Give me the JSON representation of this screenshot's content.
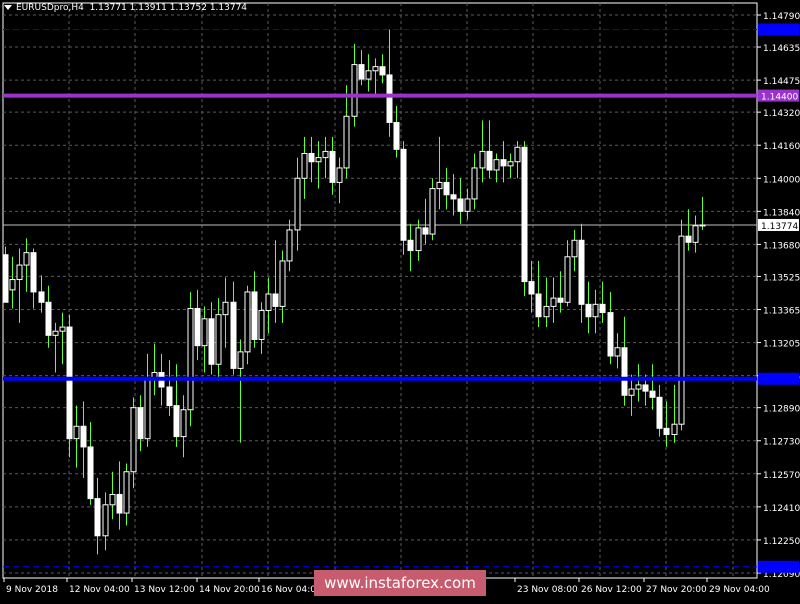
{
  "header": {
    "symbol_label": "EURUSDpro,H4",
    "ohlc": "1.13771 1.13911 1.13752 1.13774"
  },
  "watermark": "www.instaforex.com",
  "colors": {
    "background": "#000000",
    "grid": "#5a5a5a",
    "bull_body": "#000000",
    "bear_body": "#ffffff",
    "candle": "#ffffff",
    "wick": "#66ff33",
    "purple_level": "#9933cc",
    "blue_level": "#0000ff",
    "dashed_level": "#0000ff",
    "current_price": "#c0c0c0",
    "axis_text": "#ffffff"
  },
  "levels": {
    "purple": {
      "value": 1.144,
      "label": "1.14400"
    },
    "blue": {
      "value": 1.1303,
      "label": ""
    },
    "dashed_top": {
      "value": 1.1472,
      "label": ""
    },
    "dashed_bottom": {
      "value": 1.1212,
      "label": ""
    },
    "current": {
      "value": 1.13774,
      "label": "1.13774"
    }
  },
  "chart_data": {
    "type": "candlestick",
    "title": "EURUSDpro,H4",
    "y_ticks": [
      "1.14790",
      "1.14635",
      "1.14475",
      "1.14320",
      "1.14160",
      "1.14000",
      "1.13840",
      "1.13680",
      "1.13525",
      "1.13365",
      "1.13205",
      "1.13045",
      "1.12890",
      "1.12730",
      "1.12570",
      "1.12410",
      "1.12250",
      "1.12090"
    ],
    "ylim": [
      1.1203,
      1.1482
    ],
    "x_labels": [
      "9 Nov 2018",
      "12 Nov 04:00",
      "13 Nov 12:00",
      "14 Nov 20:00",
      "16 Nov 04:00",
      "",
      "23 Nov 08:00",
      "26 Nov 12:00",
      "27 Nov 20:00",
      "29 Nov 04:00"
    ],
    "candles": [
      [
        1.1363,
        1.1367,
        1.1345,
        1.134
      ],
      [
        1.1346,
        1.1362,
        1.1337,
        1.1351
      ],
      [
        1.1351,
        1.1366,
        1.133,
        1.1358
      ],
      [
        1.1358,
        1.1371,
        1.1345,
        1.1364
      ],
      [
        1.1364,
        1.1366,
        1.1337,
        1.1345
      ],
      [
        1.1345,
        1.1353,
        1.1335,
        1.134
      ],
      [
        1.134,
        1.1348,
        1.1318,
        1.1324
      ],
      [
        1.1324,
        1.133,
        1.1306,
        1.1326
      ],
      [
        1.1326,
        1.1335,
        1.131,
        1.1328
      ],
      [
        1.1328,
        1.1334,
        1.1265,
        1.1274
      ],
      [
        1.1274,
        1.129,
        1.126,
        1.128
      ],
      [
        1.128,
        1.1292,
        1.1255,
        1.127
      ],
      [
        1.127,
        1.1282,
        1.1242,
        1.1245
      ],
      [
        1.1245,
        1.1255,
        1.1218,
        1.1227
      ],
      [
        1.1227,
        1.1248,
        1.122,
        1.1242
      ],
      [
        1.1242,
        1.1258,
        1.1235,
        1.1247
      ],
      [
        1.1247,
        1.1263,
        1.123,
        1.1238
      ],
      [
        1.1238,
        1.1262,
        1.1232,
        1.1258
      ],
      [
        1.1258,
        1.1294,
        1.125,
        1.1289
      ],
      [
        1.1289,
        1.1295,
        1.1268,
        1.1274
      ],
      [
        1.1274,
        1.1315,
        1.127,
        1.1303
      ],
      [
        1.1303,
        1.132,
        1.1295,
        1.1306
      ],
      [
        1.1306,
        1.1315,
        1.129,
        1.1299
      ],
      [
        1.1299,
        1.1312,
        1.1285,
        1.129
      ],
      [
        1.129,
        1.131,
        1.127,
        1.1275
      ],
      [
        1.1275,
        1.1295,
        1.1265,
        1.1288
      ],
      [
        1.1288,
        1.1345,
        1.128,
        1.1337
      ],
      [
        1.1337,
        1.1346,
        1.1312,
        1.1319
      ],
      [
        1.1319,
        1.1338,
        1.1306,
        1.1332
      ],
      [
        1.1332,
        1.134,
        1.1305,
        1.131
      ],
      [
        1.131,
        1.1342,
        1.1302,
        1.1334
      ],
      [
        1.1334,
        1.1352,
        1.1318,
        1.134
      ],
      [
        1.134,
        1.135,
        1.1305,
        1.1308
      ],
      [
        1.1308,
        1.1322,
        1.1272,
        1.1316
      ],
      [
        1.1316,
        1.1348,
        1.131,
        1.1345
      ],
      [
        1.1345,
        1.1355,
        1.1318,
        1.1322
      ],
      [
        1.1322,
        1.134,
        1.1315,
        1.1336
      ],
      [
        1.1336,
        1.1352,
        1.1325,
        1.1344
      ],
      [
        1.1344,
        1.137,
        1.133,
        1.1338
      ],
      [
        1.1338,
        1.1365,
        1.133,
        1.136
      ],
      [
        1.136,
        1.138,
        1.1355,
        1.1375
      ],
      [
        1.1375,
        1.141,
        1.1365,
        1.14
      ],
      [
        1.14,
        1.142,
        1.139,
        1.1412
      ],
      [
        1.1412,
        1.142,
        1.1398,
        1.1408
      ],
      [
        1.1408,
        1.1418,
        1.1395,
        1.141
      ],
      [
        1.141,
        1.142,
        1.14,
        1.1413
      ],
      [
        1.1413,
        1.142,
        1.1392,
        1.1398
      ],
      [
        1.1398,
        1.141,
        1.1388,
        1.1405
      ],
      [
        1.1405,
        1.1445,
        1.14,
        1.143
      ],
      [
        1.143,
        1.1465,
        1.1425,
        1.1455
      ],
      [
        1.1455,
        1.1462,
        1.1445,
        1.1448
      ],
      [
        1.1448,
        1.146,
        1.1442,
        1.1452
      ],
      [
        1.1452,
        1.1458,
        1.144,
        1.1454
      ],
      [
        1.1454,
        1.146,
        1.1446,
        1.145
      ],
      [
        1.145,
        1.1472,
        1.142,
        1.1427
      ],
      [
        1.1427,
        1.1435,
        1.141,
        1.1414
      ],
      [
        1.1414,
        1.1418,
        1.1363,
        1.137
      ],
      [
        1.137,
        1.1378,
        1.1355,
        1.1365
      ],
      [
        1.1365,
        1.138,
        1.136,
        1.1376
      ],
      [
        1.1376,
        1.139,
        1.1368,
        1.1373
      ],
      [
        1.1373,
        1.14,
        1.137,
        1.1395
      ],
      [
        1.1395,
        1.142,
        1.1385,
        1.1398
      ],
      [
        1.1398,
        1.1405,
        1.1385,
        1.1392
      ],
      [
        1.1392,
        1.1402,
        1.1382,
        1.139
      ],
      [
        1.139,
        1.14,
        1.1378,
        1.1384
      ],
      [
        1.1384,
        1.1395,
        1.138,
        1.139
      ],
      [
        1.139,
        1.1412,
        1.1385,
        1.1405
      ],
      [
        1.1405,
        1.1428,
        1.1398,
        1.1413
      ],
      [
        1.1413,
        1.1428,
        1.14,
        1.1404
      ],
      [
        1.1404,
        1.1412,
        1.1398,
        1.1409
      ],
      [
        1.1409,
        1.1418,
        1.1398,
        1.1406
      ],
      [
        1.1406,
        1.1412,
        1.14,
        1.1408
      ],
      [
        1.1408,
        1.1418,
        1.14,
        1.1415
      ],
      [
        1.1415,
        1.1418,
        1.1343,
        1.135
      ],
      [
        1.135,
        1.136,
        1.1335,
        1.1344
      ],
      [
        1.1344,
        1.136,
        1.1328,
        1.1333
      ],
      [
        1.1333,
        1.1352,
        1.1328,
        1.1338
      ],
      [
        1.1338,
        1.1352,
        1.133,
        1.1342
      ],
      [
        1.1342,
        1.1355,
        1.1335,
        1.134
      ],
      [
        1.134,
        1.137,
        1.1338,
        1.1362
      ],
      [
        1.1362,
        1.1375,
        1.1355,
        1.137
      ],
      [
        1.137,
        1.1378,
        1.133,
        1.1339
      ],
      [
        1.1339,
        1.135,
        1.1325,
        1.1333
      ],
      [
        1.1333,
        1.1346,
        1.1325,
        1.1339
      ],
      [
        1.1339,
        1.135,
        1.133,
        1.1335
      ],
      [
        1.1335,
        1.1345,
        1.131,
        1.1314
      ],
      [
        1.1314,
        1.1325,
        1.1308,
        1.1318
      ],
      [
        1.1318,
        1.1333,
        1.129,
        1.1295
      ],
      [
        1.1295,
        1.1305,
        1.1285,
        1.1298
      ],
      [
        1.1298,
        1.131,
        1.1292,
        1.13
      ],
      [
        1.13,
        1.1305,
        1.129,
        1.1297
      ],
      [
        1.1297,
        1.131,
        1.1288,
        1.1294
      ],
      [
        1.1294,
        1.13,
        1.1275,
        1.1279
      ],
      [
        1.1279,
        1.1292,
        1.127,
        1.1276
      ],
      [
        1.1276,
        1.13,
        1.1272,
        1.1281
      ],
      [
        1.1281,
        1.138,
        1.1278,
        1.1372
      ],
      [
        1.1372,
        1.1385,
        1.1365,
        1.1369
      ],
      [
        1.1369,
        1.1382,
        1.1364,
        1.1377
      ],
      [
        1.1377,
        1.1391,
        1.1375,
        1.13774
      ]
    ]
  }
}
